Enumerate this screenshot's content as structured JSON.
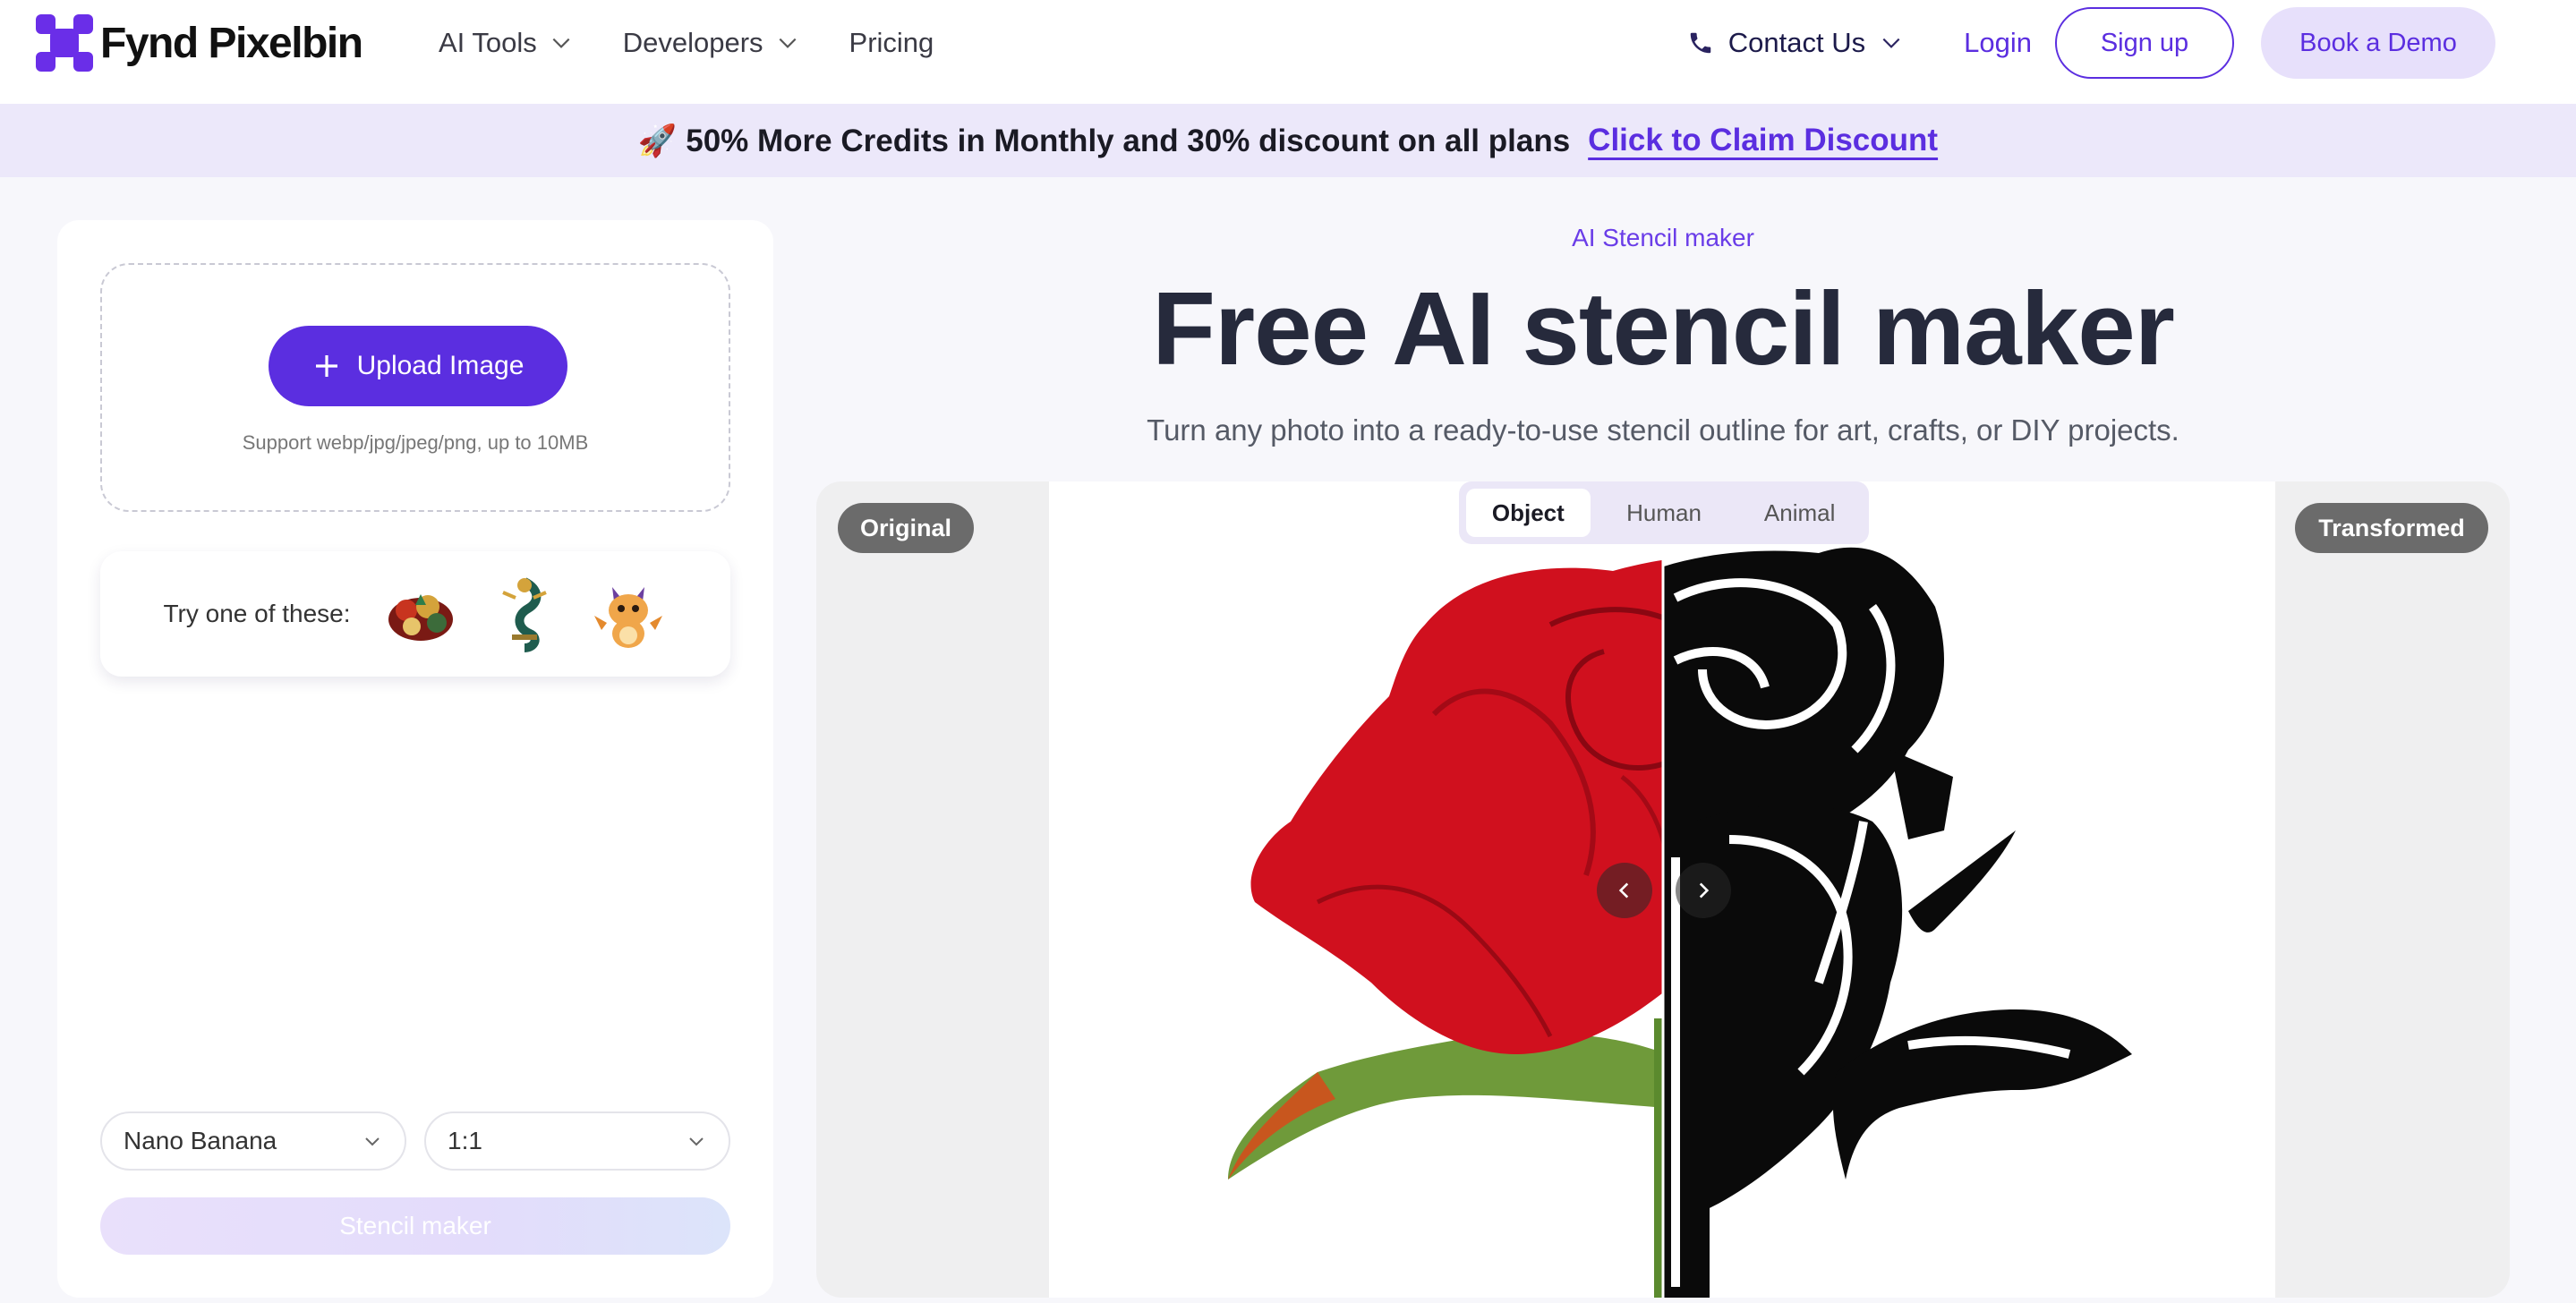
{
  "header": {
    "logo_text": "Fynd Pixelbin",
    "nav": [
      {
        "label": "AI Tools",
        "has_dropdown": true
      },
      {
        "label": "Developers",
        "has_dropdown": true
      },
      {
        "label": "Pricing",
        "has_dropdown": false
      }
    ],
    "contact_label": "Contact Us",
    "login_label": "Login",
    "signup_label": "Sign up",
    "demo_label": "Book a Demo"
  },
  "banner": {
    "emoji": "🚀",
    "text": "50% More Credits in Monthly and 30% discount on all plans",
    "link": "Click to Claim Discount"
  },
  "left_panel": {
    "upload_label": "Upload Image",
    "upload_hint": "Support webp/jpg/jpeg/png, up to 10MB",
    "samples_label": "Try one of these:",
    "model_select": "Nano Banana",
    "ratio_select": "1:1",
    "submit_label": "Stencil maker"
  },
  "hero": {
    "eyebrow": "AI Stencil maker",
    "title": "Free AI stencil maker",
    "subtitle": "Turn any photo into a ready-to-use stencil outline for art, crafts, or DIY projects."
  },
  "showcase": {
    "original_label": "Original",
    "transformed_label": "Transformed",
    "tabs": [
      "Object",
      "Human",
      "Animal"
    ],
    "active_tab": "Object"
  },
  "colors": {
    "brand": "#5b2ee0",
    "banner_bg": "#ece8fa",
    "rose_red": "#d0101e"
  }
}
